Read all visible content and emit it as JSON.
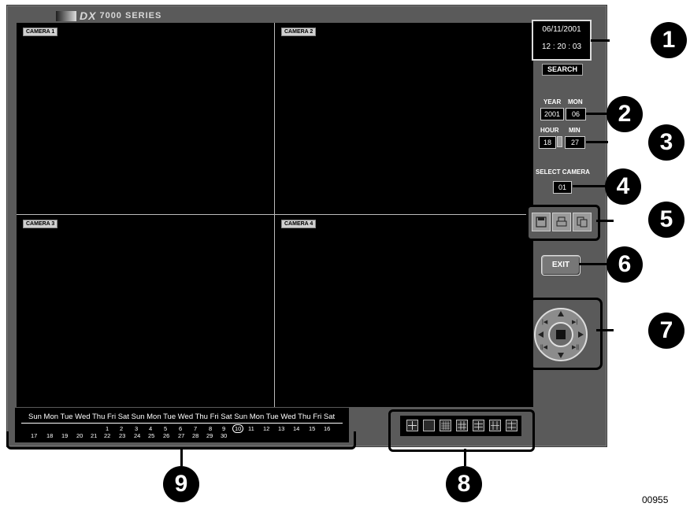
{
  "brand": {
    "logo_text": "DX",
    "series": "7000 SERIES"
  },
  "cameras": [
    "CAMERA 1",
    "CAMERA 2",
    "CAMERA 3",
    "CAMERA 4"
  ],
  "clock": {
    "date": "06/11/2001",
    "time": "12 : 20 : 03"
  },
  "search_label": "SEARCH",
  "time_search": {
    "year_label": "YEAR",
    "year_value": "2001",
    "mon_label": "MON",
    "mon_value": "06",
    "hour_label": "HOUR",
    "hour_value": "18",
    "min_label": "MIN",
    "min_value": "27"
  },
  "select_camera": {
    "label": "SELECT CAMERA",
    "value": "01"
  },
  "action_icons": [
    "save-icon",
    "print-icon",
    "copy-icon"
  ],
  "exit_label": "EXIT",
  "calendar": {
    "weekdays": "Sun Mon Tue Wed Thu Fri Sat Sun Mon Tue Wed Thu Fri Sat Sun Mon Tue Wed Thu Fri Sat",
    "days": [
      "17",
      "18",
      "19",
      "20",
      "21",
      "1",
      "2",
      "3",
      "4",
      "5",
      "6",
      "7",
      "8",
      "9",
      "10",
      "11",
      "12",
      "13",
      "14",
      "15",
      "16",
      "22",
      "23",
      "24",
      "25",
      "26",
      "27",
      "28",
      "29",
      "30"
    ],
    "selected_day": "10"
  },
  "layout_icons": [
    "quad-layout-icon",
    "single-layout-icon",
    "sixteen-layout-icon",
    "nine-layout-icon",
    "six-layout-icon",
    "eight-layout-icon",
    "ten-layout-icon"
  ],
  "callouts": [
    "1",
    "2",
    "3",
    "4",
    "5",
    "6",
    "7",
    "8",
    "9"
  ],
  "figure_id": "00955"
}
